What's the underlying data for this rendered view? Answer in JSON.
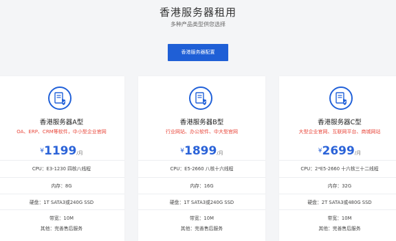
{
  "page": {
    "title": "香港服务器租用",
    "subtitle": "多种产品类型供您选择",
    "cta_label": "香港服务器配置"
  },
  "colors": {
    "accent": "#1f5fd6",
    "price": "#2b63d8",
    "desc_red": "#e8463a",
    "background": "#f4f5f7"
  },
  "plans": [
    {
      "icon": "server-shield-icon",
      "name": "香港服务器A型",
      "desc": "OA、ERP、CRM等软件，中小型企业官网",
      "currency": "¥",
      "price": "1199",
      "unit": "/月",
      "specs": [
        "CPU：E3-1230 四核八线程",
        "内存：8G",
        "硬盘：1T SATA3或240G SSD",
        "带宽：10M",
        "其他：完善售后服务"
      ]
    },
    {
      "icon": "server-shield-icon",
      "name": "香港服务器B型",
      "desc": "行业网站、办公软件、中大型官网",
      "currency": "¥",
      "price": "1899",
      "unit": "/月",
      "specs": [
        "CPU：E5-2660 八核十六线程",
        "内存：16G",
        "硬盘：1T SATA3或240G SSD",
        "带宽：10M",
        "其他：完善售后服务"
      ]
    },
    {
      "icon": "server-shield-icon",
      "name": "香港服务器C型",
      "desc": "大型企业官网、互联网平台、商城网站",
      "currency": "¥",
      "price": "2699",
      "unit": "/月",
      "specs": [
        "CPU：2*E5-2660 十六核三十二线程",
        "内存：32G",
        "硬盘：2T SATA3或480G SSD",
        "带宽：10M",
        "其他：完善售后服务"
      ]
    }
  ]
}
